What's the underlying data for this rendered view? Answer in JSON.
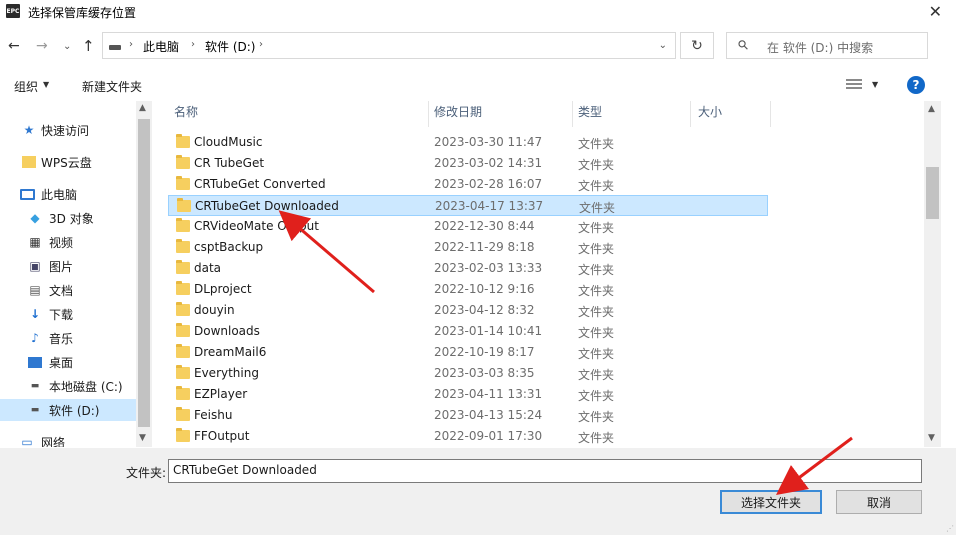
{
  "window": {
    "title": "选择保管库缓存位置",
    "app_icon_text": "EPC"
  },
  "nav": {
    "breadcrumb": [
      "此电脑",
      "软件 (D:)"
    ],
    "search_placeholder": "在 软件 (D:) 中搜索"
  },
  "toolbar": {
    "organize": "组织",
    "new_folder": "新建文件夹",
    "help": "?"
  },
  "sidebar": {
    "items": [
      {
        "label": "快速访问",
        "icon": "star-icon"
      },
      {
        "label": "WPS云盘",
        "icon": "folder-icon"
      },
      {
        "label": "此电脑",
        "icon": "computer-icon"
      },
      {
        "label": "3D 对象",
        "icon": "cube-icon"
      },
      {
        "label": "视频",
        "icon": "film-icon"
      },
      {
        "label": "图片",
        "icon": "image-icon"
      },
      {
        "label": "文档",
        "icon": "document-icon"
      },
      {
        "label": "下载",
        "icon": "download-icon"
      },
      {
        "label": "音乐",
        "icon": "music-icon"
      },
      {
        "label": "桌面",
        "icon": "desktop-icon"
      },
      {
        "label": "本地磁盘 (C:)",
        "icon": "drive-icon"
      },
      {
        "label": "软件 (D:)",
        "icon": "drive-icon",
        "selected": true
      },
      {
        "label": "网络",
        "icon": "network-icon"
      }
    ]
  },
  "columns": {
    "name": "名称",
    "date": "修改日期",
    "type": "类型",
    "size": "大小"
  },
  "files": [
    {
      "name": "CloudMusic",
      "date": "2023-03-30 11:47",
      "type": "文件夹"
    },
    {
      "name": "CR TubeGet",
      "date": "2023-03-02 14:31",
      "type": "文件夹"
    },
    {
      "name": "CRTubeGet Converted",
      "date": "2023-02-28 16:07",
      "type": "文件夹"
    },
    {
      "name": "CRTubeGet Downloaded",
      "date": "2023-04-17 13:37",
      "type": "文件夹",
      "selected": true
    },
    {
      "name": "CRVideoMate Output",
      "date": "2022-12-30 8:44",
      "type": "文件夹"
    },
    {
      "name": "csptBackup",
      "date": "2022-11-29 8:18",
      "type": "文件夹"
    },
    {
      "name": "data",
      "date": "2023-02-03 13:33",
      "type": "文件夹"
    },
    {
      "name": "DLproject",
      "date": "2022-10-12 9:16",
      "type": "文件夹"
    },
    {
      "name": "douyin",
      "date": "2023-04-12 8:32",
      "type": "文件夹"
    },
    {
      "name": "Downloads",
      "date": "2023-01-14 10:41",
      "type": "文件夹"
    },
    {
      "name": "DreamMail6",
      "date": "2022-10-19 8:17",
      "type": "文件夹"
    },
    {
      "name": "Everything",
      "date": "2023-03-03 8:35",
      "type": "文件夹"
    },
    {
      "name": "EZPlayer",
      "date": "2023-04-11 13:31",
      "type": "文件夹"
    },
    {
      "name": "Feishu",
      "date": "2023-04-13 15:24",
      "type": "文件夹"
    },
    {
      "name": "FFOutput",
      "date": "2022-09-01 17:30",
      "type": "文件夹"
    }
  ],
  "footer": {
    "folder_label": "文件夹:",
    "folder_value": "CRTubeGet Downloaded",
    "select_button": "选择文件夹",
    "cancel_button": "取消"
  }
}
